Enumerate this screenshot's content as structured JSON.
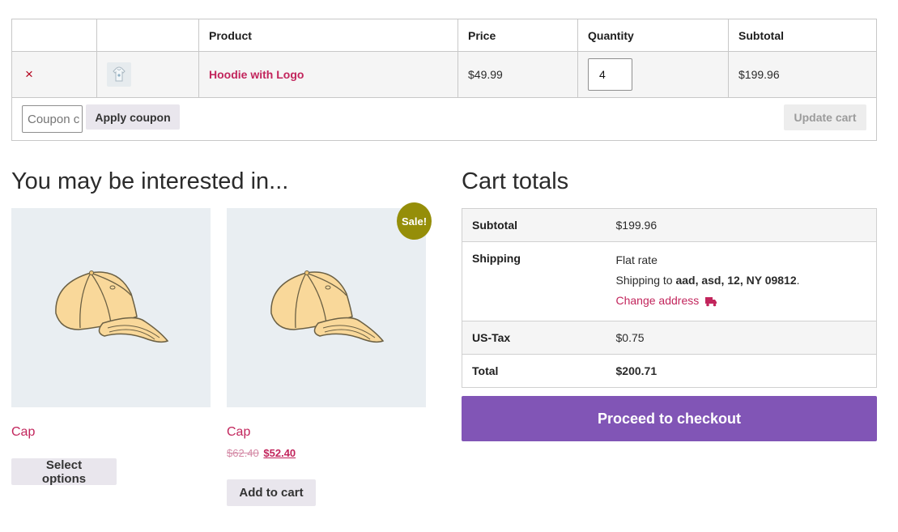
{
  "cart": {
    "headers": {
      "product": "Product",
      "price": "Price",
      "quantity": "Quantity",
      "subtotal": "Subtotal"
    },
    "item": {
      "remove_symbol": "×",
      "product_name": "Hoodie with Logo",
      "price": "$49.99",
      "quantity": "4",
      "subtotal": "$199.96"
    },
    "coupon_placeholder": "Coupon code",
    "apply_coupon_label": "Apply coupon",
    "update_cart_label": "Update cart"
  },
  "cross_sells": {
    "heading": "You may be interested in...",
    "products": [
      {
        "name": "Cap",
        "button": "Select options"
      },
      {
        "name": "Cap",
        "old_price": "$62.40",
        "new_price": "$52.40",
        "badge": "Sale!",
        "button": "Add to cart"
      }
    ]
  },
  "totals": {
    "heading": "Cart totals",
    "subtotal_label": "Subtotal",
    "subtotal_value": "$199.96",
    "shipping_label": "Shipping",
    "shipping_method": "Flat rate",
    "shipping_to_prefix": "Shipping to ",
    "shipping_address": "aad, asd, 12, NY 09812",
    "shipping_to_suffix": ".",
    "change_address": "Change address",
    "tax_label": "US-Tax",
    "tax_value": "$0.75",
    "total_label": "Total",
    "total_value": "$200.71",
    "checkout_label": "Proceed to checkout"
  },
  "colors": {
    "accent": "#c2255c",
    "checkout": "#8155b6",
    "sale_badge": "#958e09",
    "remove": "#b3001b"
  }
}
